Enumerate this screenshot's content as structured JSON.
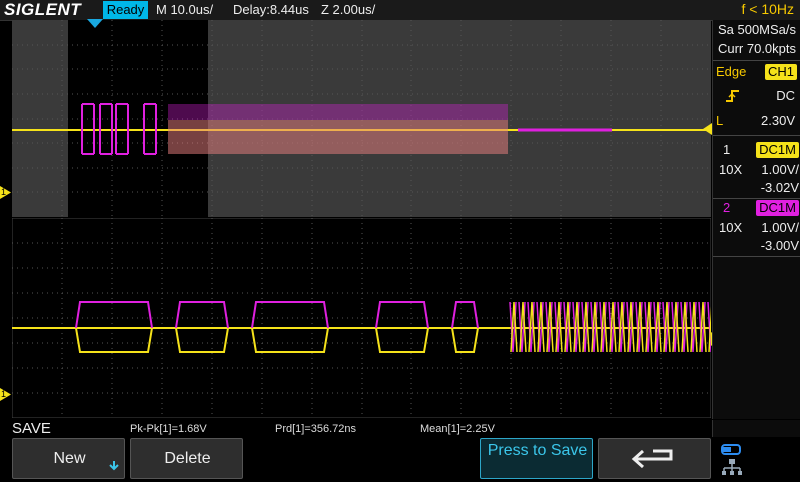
{
  "topbar": {
    "brand": "SIGLENT",
    "status": "Ready",
    "timebase": "M 10.0us/",
    "delay": "Delay:8.44us",
    "zoom": "Z 2.00us/",
    "frequency": "f < 10Hz"
  },
  "acquisition": {
    "sample_rate": "Sa 500MSa/s",
    "memory": "Curr 70.0kpts"
  },
  "trigger": {
    "type": "Edge",
    "source": "CH1",
    "slope_icon": "rising-edge-icon",
    "coupling": "DC",
    "level_label": "L",
    "level": "2.30V"
  },
  "channels": [
    {
      "number": "1",
      "coupling": "DC1M",
      "probe": "10X",
      "scale": "1.00V/",
      "offset": "-3.02V",
      "color": "#f5e21a"
    },
    {
      "number": "2",
      "coupling": "DC1M",
      "probe": "10X",
      "scale": "1.00V/",
      "offset": "-3.00V",
      "color": "#e020e0"
    }
  ],
  "markers": {
    "ch1_marker": "1"
  },
  "menu": {
    "title": "SAVE"
  },
  "measurements": [
    "Pk-Pk[1]=1.68V",
    "Prd[1]=356.72ns",
    "Mean[1]=2.25V"
  ],
  "softkeys": {
    "new_label": "New",
    "delete_label": "Delete",
    "press_to_save_label": "Press to Save",
    "back_icon": "return-arrow-icon",
    "network_icon": "network-usb-icon"
  },
  "colors": {
    "ch1": "#f5e21a",
    "ch2": "#e020e0",
    "accent": "#00b7e8"
  }
}
